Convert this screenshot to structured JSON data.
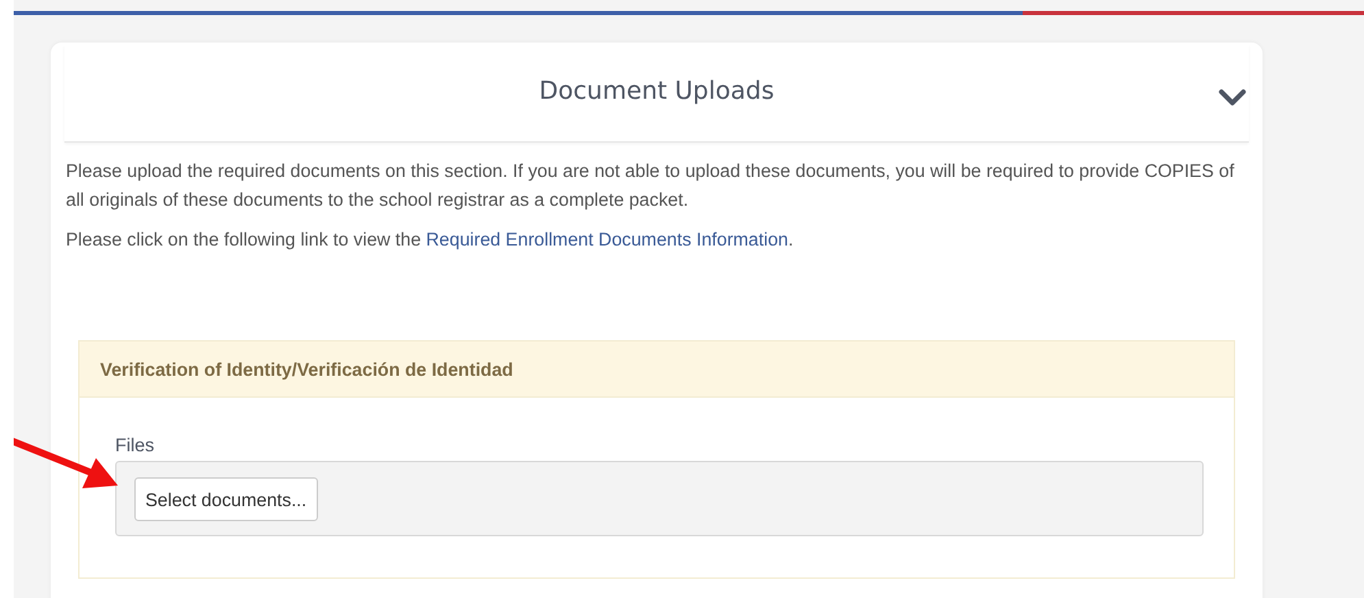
{
  "progress": {
    "level": 0.74
  },
  "section": {
    "title": "Document Uploads",
    "expanded": true,
    "intro": "Please upload the required documents on this section. If you are not able to upload these documents, you will be required to provide COPIES of all originals of these documents to the school registrar as a complete packet.",
    "link_sentence": "Please click on the following link to view the ",
    "link": "Required Enrollment Documents Information",
    "link_end": "."
  },
  "panel": {
    "title": "Verification of Identity/Verificación de Identidad",
    "files_label": "Files",
    "button": "Select documents..."
  }
}
